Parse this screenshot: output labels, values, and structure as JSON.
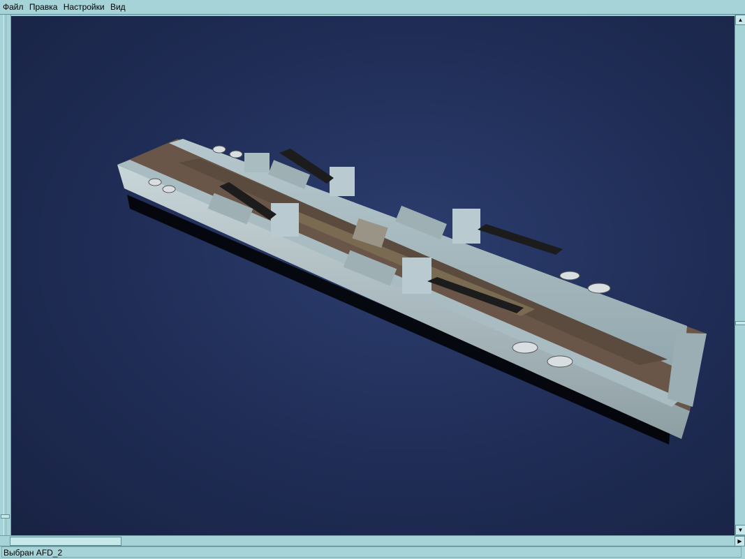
{
  "menu": {
    "items": [
      "Файл",
      "Правка",
      "Настройки",
      "Вид"
    ]
  },
  "scrollbars": {
    "up_arrow": "▲",
    "down_arrow": "▼",
    "right_arrow": "▶"
  },
  "status": {
    "text": "Выбран AFD_2"
  },
  "colors": {
    "ui_background": "#a6d3d8",
    "ocean": "#1f2c55",
    "hull": "#b4c3c7",
    "deck": "#6a5648"
  }
}
